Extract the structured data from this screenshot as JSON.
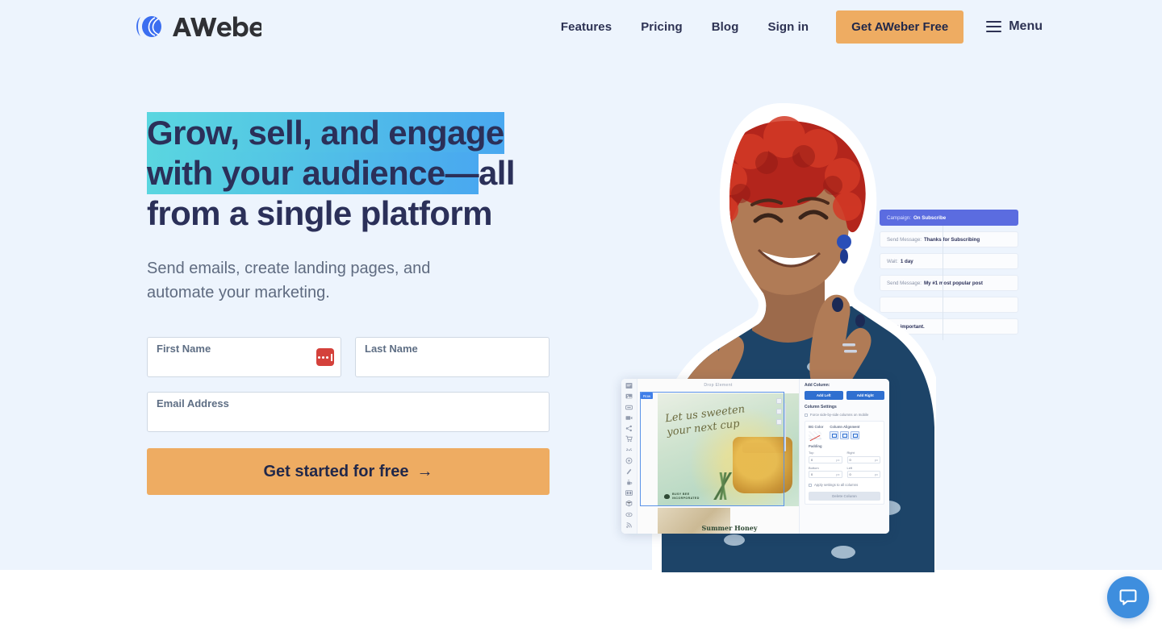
{
  "header": {
    "logo_text": "AWeber",
    "nav_links": [
      {
        "label": "Features"
      },
      {
        "label": "Pricing"
      },
      {
        "label": "Blog"
      },
      {
        "label": "Sign in"
      }
    ],
    "cta_label": "Get AWeber Free",
    "menu_label": "Menu"
  },
  "hero": {
    "headline_highlight": "Grow, sell, and engage with your audience—",
    "headline_rest": "all from a single platform",
    "subheadline": "Send emails, create landing pages, and automate your marketing.",
    "form": {
      "first_name_label": "First Name",
      "first_name_value": "",
      "last_name_label": "Last Name",
      "last_name_value": "",
      "email_label": "Email Address",
      "email_value": "",
      "autofill_icon": "lastpass-icon",
      "submit_label": "Get started for free",
      "submit_arrow": "→"
    }
  },
  "art": {
    "automation": {
      "rows": [
        {
          "prefix": "Campaign:",
          "value": "On Subscribe",
          "active": true
        },
        {
          "prefix": "Send Message:",
          "value": "Thanks for Subscribing",
          "active": false
        },
        {
          "prefix": "Wait:",
          "value": "1 day",
          "active": false
        },
        {
          "prefix": "Send Message:",
          "value": "My #1 most popular post",
          "active": false
        },
        {
          "prefix": "",
          "value": "",
          "active": false
        },
        {
          "prefix": "",
          "value": "'s is important.",
          "active": false
        }
      ]
    },
    "editor": {
      "drop_hint": "Drop Element",
      "row_tag": "Row",
      "email_script_line1": "Let us sweeten",
      "email_script_line2": "your next cup",
      "brand_line1": "BUSY BEE",
      "brand_line2": "INCORPORATED",
      "product_title": "Summer Honey",
      "sidebar": {
        "add_column_title": "Add Column:",
        "add_left": "Add Left",
        "add_right": "Add Right",
        "column_settings_title": "Column Settings",
        "force_side_by_side": "Force side-by-side columns on mobile",
        "bg_color_label": "BG Color",
        "column_alignment_label": "Column Alignment",
        "padding_label": "Padding",
        "pad_top_label": "Top",
        "pad_top_value": "0",
        "pad_right_label": "Right",
        "pad_right_value": "0",
        "pad_bottom_label": "Bottom",
        "pad_bottom_value": "0",
        "pad_left_label": "Left",
        "pad_left_value": "0",
        "unit": "px",
        "apply_all": "Apply settings to all columns",
        "delete_column": "Delete Column"
      }
    }
  },
  "chat": {
    "icon": "chat-bubble-icon"
  },
  "colors": {
    "hero_background": "#edf4fd",
    "page_background": "#ffffff",
    "heading": "#2b3059",
    "highlight_start": "#5ad6e0",
    "highlight_end": "#49a8f0",
    "accent_orange": "#eeac62",
    "logo_blue": "#3b6ef0",
    "chat_blue": "#3e8ede",
    "autofill_red": "#d4413b"
  }
}
